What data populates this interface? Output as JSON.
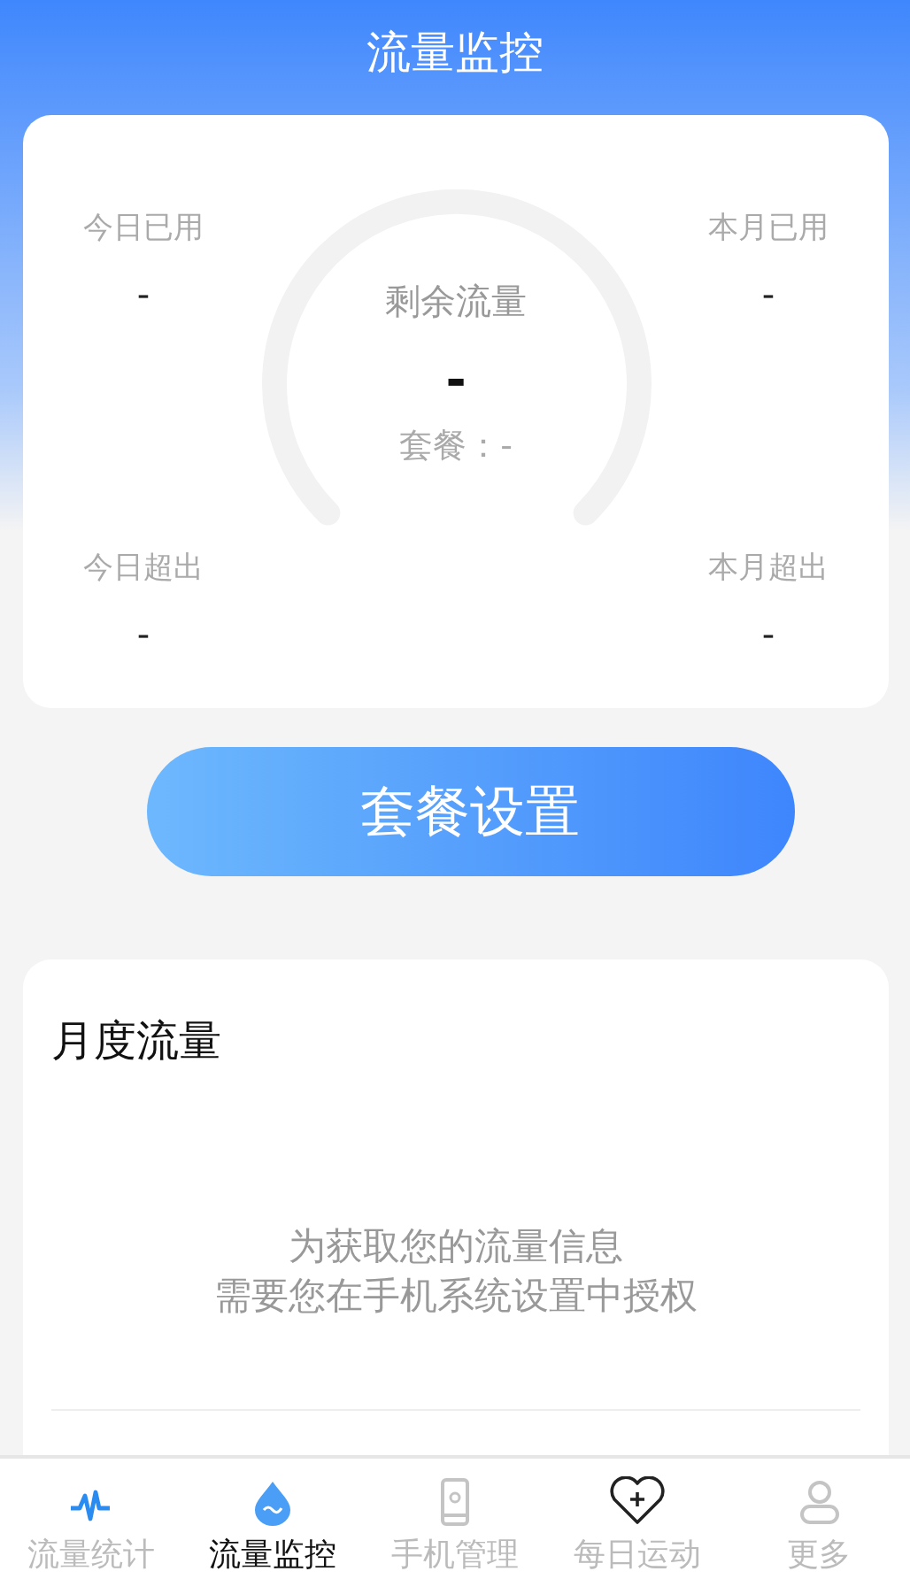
{
  "header": {
    "title": "流量监控"
  },
  "stats": [
    {
      "label": "今日已用",
      "value": "-"
    },
    {
      "label": "本月已用",
      "value": "-"
    },
    {
      "label": "今日超出",
      "value": "-"
    },
    {
      "label": "本月超出",
      "value": "-"
    }
  ],
  "gauge": {
    "label": "剩余流量",
    "value": "-",
    "plan": "套餐：-"
  },
  "plan_button": "套餐设置",
  "monthly": {
    "title": "月度流量",
    "message_lines": [
      "为获取您的流量信息",
      "需要您在手机系统设置中授权"
    ]
  },
  "tabs": [
    {
      "kind": "pulse",
      "label": "流量统计",
      "selected": false
    },
    {
      "kind": "drop",
      "label": "流量监控",
      "selected": true
    },
    {
      "kind": "phone",
      "label": "手机管理",
      "selected": false
    },
    {
      "kind": "heart",
      "label": "每日运动",
      "selected": false
    },
    {
      "kind": "person",
      "label": "更多",
      "selected": false
    }
  ]
}
